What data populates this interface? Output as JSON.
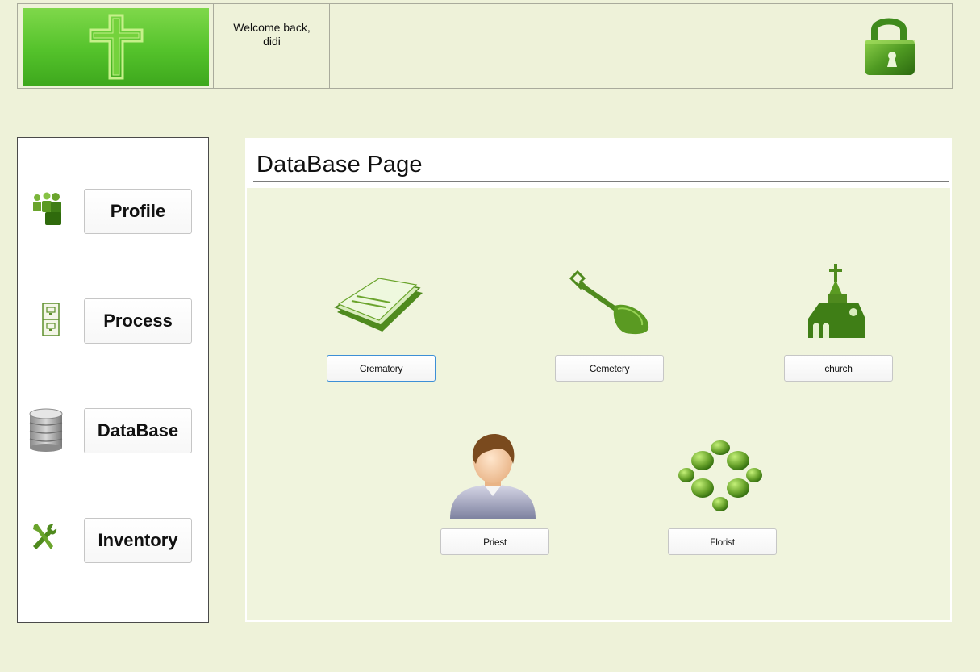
{
  "header": {
    "logo_icon": "cross-icon",
    "welcome_text": "Welcome back,",
    "username": "didi",
    "logout_icon": "padlock-icon"
  },
  "sidebar": {
    "items": [
      {
        "label": "Profile",
        "icon": "people-icon"
      },
      {
        "label": "Process",
        "icon": "filing-cabinet-icon"
      },
      {
        "label": "DataBase",
        "icon": "database-icon"
      },
      {
        "label": "Inventory",
        "icon": "tools-icon"
      }
    ]
  },
  "main": {
    "title": "DataBase Page",
    "items": [
      {
        "label": "Crematory",
        "icon": "paper-stack-icon"
      },
      {
        "label": "Cemetery",
        "icon": "shovel-icon"
      },
      {
        "label": "church",
        "icon": "church-icon"
      },
      {
        "label": "Priest",
        "icon": "priest-icon"
      },
      {
        "label": "Florist",
        "icon": "flower-icon"
      }
    ]
  },
  "colors": {
    "background": "#eef2d9",
    "accent_green": "#54c22b",
    "focus_border": "#3d8fd6"
  }
}
